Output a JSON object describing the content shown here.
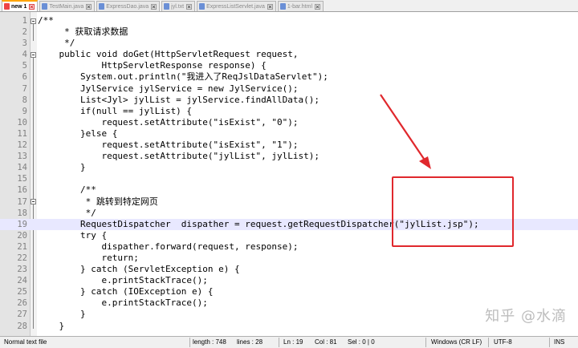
{
  "tabs": [
    {
      "label": "new 1",
      "active": true
    },
    {
      "label": "TestMain.java",
      "active": false
    },
    {
      "label": "ExpressDao.java",
      "active": false
    },
    {
      "label": "jyl.txt",
      "active": false
    },
    {
      "label": "ExpressListServlet.java",
      "active": false
    },
    {
      "label": "1-bar.html",
      "active": false
    }
  ],
  "code_lines": [
    {
      "n": "1",
      "text": "/**"
    },
    {
      "n": "2",
      "text": "     * 获取请求数据"
    },
    {
      "n": "3",
      "text": "     */"
    },
    {
      "n": "4",
      "text": "    public void doGet(HttpServletRequest request,"
    },
    {
      "n": "5",
      "text": "            HttpServletResponse response) {"
    },
    {
      "n": "6",
      "text": "        System.out.println(\"我进入了ReqJslDataServlet\");"
    },
    {
      "n": "7",
      "text": "        JylService jylService = new JylService();"
    },
    {
      "n": "8",
      "text": "        List<Jyl> jylList = jylService.findAllData();"
    },
    {
      "n": "9",
      "text": "        if(null == jylList) {"
    },
    {
      "n": "10",
      "text": "            request.setAttribute(\"isExist\", \"0\");"
    },
    {
      "n": "11",
      "text": "        }else {"
    },
    {
      "n": "12",
      "text": "            request.setAttribute(\"isExist\", \"1\");"
    },
    {
      "n": "13",
      "text": "            request.setAttribute(\"jylList\", jylList);"
    },
    {
      "n": "14",
      "text": "        }"
    },
    {
      "n": "15",
      "text": ""
    },
    {
      "n": "16",
      "text": "        /**"
    },
    {
      "n": "17",
      "text": "         * 跳转到特定网页"
    },
    {
      "n": "18",
      "text": "         */"
    },
    {
      "n": "19",
      "text": "        RequestDispatcher  dispather = request.getRequestDispatcher(\"jylList.jsp\");"
    },
    {
      "n": "20",
      "text": "        try {"
    },
    {
      "n": "21",
      "text": "            dispather.forward(request, response);"
    },
    {
      "n": "22",
      "text": "            return;"
    },
    {
      "n": "23",
      "text": "        } catch (ServletException e) {"
    },
    {
      "n": "24",
      "text": "            e.printStackTrace();"
    },
    {
      "n": "25",
      "text": "        } catch (IOException e) {"
    },
    {
      "n": "26",
      "text": "            e.printStackTrace();"
    },
    {
      "n": "27",
      "text": "        }"
    },
    {
      "n": "28",
      "text": "    }"
    }
  ],
  "current_line": "19",
  "watermark": "知乎 @水滴",
  "status": {
    "file_type": "Normal text file",
    "length": "length : 748",
    "lines": "lines : 28",
    "ln": "Ln : 19",
    "col": "Col : 81",
    "sel": "Sel : 0 | 0",
    "eol": "Windows (CR LF)",
    "encoding": "UTF-8",
    "mode": "INS"
  },
  "colors": {
    "annotation_red": "#e0282d",
    "current_line_bg": "#e8e8ff",
    "active_tab_accent": "#ffa500"
  }
}
